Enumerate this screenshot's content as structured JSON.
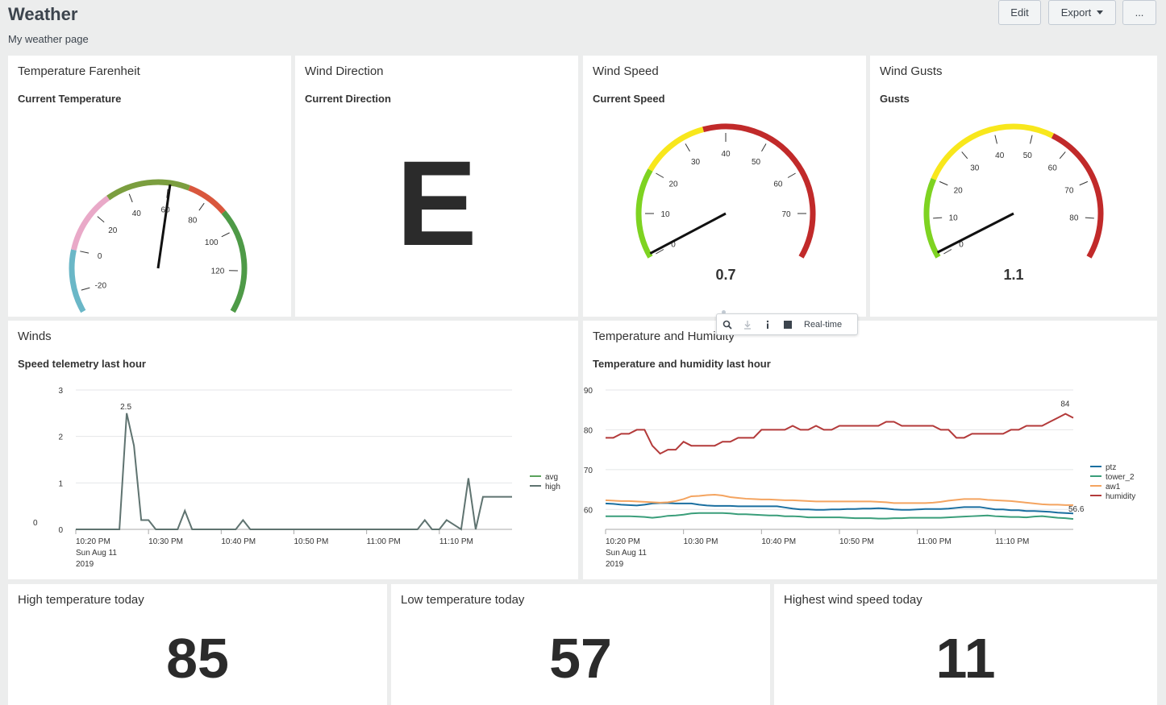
{
  "header": {
    "title": "Weather",
    "description": "My weather page",
    "edit_label": "Edit",
    "export_label": "Export",
    "more_label": "..."
  },
  "panels": {
    "temperature": {
      "title": "Temperature Farenheit",
      "subtitle": "Current Temperature",
      "value": "60.8"
    },
    "wind_direction": {
      "title": "Wind Direction",
      "subtitle": "Current Direction",
      "value": "E"
    },
    "wind_speed": {
      "title": "Wind Speed",
      "subtitle": "Current Speed",
      "value": "0.7"
    },
    "wind_gusts": {
      "title": "Wind Gusts",
      "subtitle": "Gusts",
      "value": "1.1"
    },
    "winds": {
      "title": "Winds",
      "subtitle": "Speed telemetry last hour"
    },
    "temp_humidity": {
      "title": "Temperature and Humidity",
      "subtitle": "Temperature and humidity last hour"
    },
    "high_temp": {
      "title": "High temperature today",
      "value": "85"
    },
    "low_temp": {
      "title": "Low temperature today",
      "value": "57"
    },
    "high_wind": {
      "title": "Highest wind speed today",
      "value": "11"
    }
  },
  "toolbar": {
    "realtime_label": "Real-time"
  },
  "gauges": {
    "temperature": {
      "min": -30,
      "max": 140,
      "value": 60.8,
      "ticks": [
        -20,
        0,
        20,
        40,
        60,
        80,
        100,
        120
      ],
      "bands": [
        {
          "from": -30,
          "to": 0,
          "color": "#6ab7c7"
        },
        {
          "from": 0,
          "to": 30,
          "color": "#e9a9c8"
        },
        {
          "from": 30,
          "to": 70,
          "color": "#7b9e3f"
        },
        {
          "from": 70,
          "to": 90,
          "color": "#d9573d"
        },
        {
          "from": 90,
          "to": 140,
          "color": "#4e9a47"
        }
      ]
    },
    "wind_speed": {
      "min": 0,
      "max": 80,
      "value": 0.7,
      "ticks": [
        0,
        10,
        20,
        30,
        40,
        50,
        60,
        70
      ],
      "bands": [
        {
          "from": 0,
          "to": 20,
          "color": "#7ed321"
        },
        {
          "from": 20,
          "to": 35,
          "color": "#f8e71c"
        },
        {
          "from": 35,
          "to": 80,
          "color": "#c12a2a"
        }
      ]
    },
    "wind_gusts": {
      "min": 0,
      "max": 90,
      "value": 1.1,
      "ticks": [
        0,
        10,
        20,
        30,
        40,
        50,
        60,
        70,
        80
      ],
      "bands": [
        {
          "from": 0,
          "to": 20,
          "color": "#7ed321"
        },
        {
          "from": 20,
          "to": 55,
          "color": "#f8e71c"
        },
        {
          "from": 55,
          "to": 90,
          "color": "#c12a2a"
        }
      ]
    }
  },
  "chart_data": [
    {
      "type": "line",
      "title": "Speed telemetry last hour",
      "ylim": [
        0,
        3
      ],
      "yticks": [
        0,
        1,
        2,
        3
      ],
      "xticks": [
        "10:20 PM\nSun Aug 11\n2019",
        "10:30 PM",
        "10:40 PM",
        "10:50 PM",
        "11:00 PM",
        "11:10 PM"
      ],
      "x_range_minutes": [
        0,
        60
      ],
      "series": [
        {
          "name": "avg",
          "color": "#5aa25c",
          "values": []
        },
        {
          "name": "high",
          "color": "#5f7370",
          "x": [
            0,
            6,
            7,
            8,
            9,
            10,
            11,
            14,
            15,
            16,
            17,
            18,
            22,
            23,
            24,
            26,
            28,
            30,
            40,
            47,
            48,
            49,
            50,
            51,
            53,
            54,
            55,
            56,
            60
          ],
          "values": [
            0,
            0,
            2.5,
            1.8,
            0.2,
            0.2,
            0,
            0,
            0.4,
            0,
            0,
            0,
            0,
            0.2,
            0,
            0,
            0,
            0,
            0,
            0,
            0.2,
            0,
            0,
            0.2,
            0,
            1.1,
            0,
            0.7,
            0.7
          ]
        }
      ],
      "data_labels": [
        {
          "text": "2.5",
          "x": 7,
          "y": 2.5
        },
        {
          "text": "0",
          "x": 0,
          "y": 0
        }
      ],
      "legend": "right"
    },
    {
      "type": "line",
      "title": "Temperature and humidity last hour",
      "ylim": [
        55,
        90
      ],
      "yticks": [
        60,
        70,
        80,
        90
      ],
      "xticks": [
        "10:20 PM\nSun Aug 11\n2019",
        "10:30 PM",
        "10:40 PM",
        "10:50 PM",
        "11:00 PM",
        "11:10 PM"
      ],
      "x_range_minutes": [
        0,
        60
      ],
      "series": [
        {
          "name": "ptz",
          "color": "#1a6fa0",
          "values": [
            61.5,
            61.4,
            61.2,
            61.1,
            61.0,
            61.2,
            61.5,
            61.6,
            61.6,
            61.5,
            61.5,
            61.5,
            61.2,
            61.0,
            60.9,
            60.9,
            60.9,
            60.8,
            60.8,
            60.8,
            60.8,
            60.8,
            60.8,
            60.5,
            60.2,
            60.0,
            60.0,
            59.9,
            59.9,
            60.0,
            60.0,
            60.1,
            60.1,
            60.2,
            60.2,
            60.3,
            60.2,
            60.0,
            59.9,
            59.9,
            60.0,
            60.1,
            60.1,
            60.1,
            60.2,
            60.4,
            60.6,
            60.6,
            60.6,
            60.3,
            60.0,
            60.0,
            59.8,
            59.8,
            59.6,
            59.6,
            59.5,
            59.4,
            59.2,
            59.1,
            59.0
          ]
        },
        {
          "name": "tower_2",
          "color": "#3a9e7a",
          "values": [
            58.3,
            58.3,
            58.3,
            58.3,
            58.2,
            58.1,
            57.9,
            58.1,
            58.4,
            58.5,
            58.7,
            59.0,
            59.1,
            59.1,
            59.1,
            59.1,
            59.0,
            58.8,
            58.8,
            58.7,
            58.6,
            58.5,
            58.5,
            58.3,
            58.3,
            58.2,
            58.0,
            58.0,
            58.0,
            58.0,
            58.0,
            57.9,
            57.8,
            57.8,
            57.8,
            57.7,
            57.7,
            57.8,
            57.8,
            57.9,
            57.9,
            57.9,
            57.9,
            57.9,
            58.0,
            58.1,
            58.2,
            58.3,
            58.4,
            58.5,
            58.3,
            58.2,
            58.1,
            58.1,
            58.0,
            58.2,
            58.3,
            58.1,
            57.9,
            57.8,
            57.6
          ]
        },
        {
          "name": "awl",
          "color": "#f4a460",
          "values": [
            62.3,
            62.2,
            62.1,
            62.1,
            62.0,
            61.9,
            61.8,
            61.7,
            61.8,
            62.1,
            62.6,
            63.3,
            63.4,
            63.6,
            63.7,
            63.5,
            63.1,
            62.9,
            62.7,
            62.6,
            62.5,
            62.5,
            62.4,
            62.3,
            62.3,
            62.2,
            62.1,
            62.0,
            62.0,
            62.0,
            62.0,
            62.0,
            62.0,
            62.0,
            62.0,
            61.9,
            61.8,
            61.6,
            61.6,
            61.6,
            61.6,
            61.6,
            61.7,
            61.9,
            62.2,
            62.4,
            62.6,
            62.6,
            62.6,
            62.4,
            62.3,
            62.2,
            62.1,
            61.9,
            61.7,
            61.5,
            61.3,
            61.2,
            61.2,
            61.1,
            61.1
          ]
        },
        {
          "name": "humidity",
          "color": "#b33a3a",
          "values": [
            78,
            78,
            79,
            79,
            80,
            80,
            76,
            74,
            75,
            75,
            77,
            76,
            76,
            76,
            76,
            77,
            77,
            78,
            78,
            78,
            80,
            80,
            80,
            80,
            81,
            80,
            80,
            81,
            80,
            80,
            81,
            81,
            81,
            81,
            81,
            81,
            82,
            82,
            81,
            81,
            81,
            81,
            81,
            80,
            80,
            78,
            78,
            79,
            79,
            79,
            79,
            79,
            80,
            80,
            81,
            81,
            81,
            82,
            83,
            84,
            83
          ]
        }
      ],
      "data_labels": [
        {
          "text": "84",
          "series": "humidity",
          "index": 59
        },
        {
          "text": "56.6",
          "series": "tower_2",
          "index": 60
        }
      ],
      "legend": "right",
      "legend_labels": [
        "ptz",
        "tower_2",
        "aw1",
        "humidity"
      ]
    }
  ]
}
